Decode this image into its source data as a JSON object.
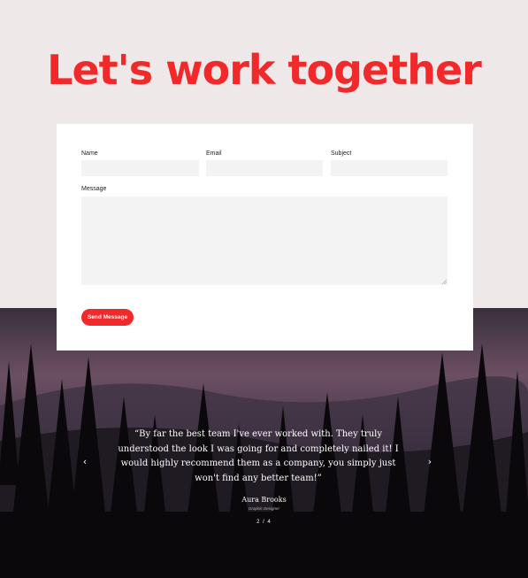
{
  "headline": "Let's work together",
  "form": {
    "name_label": "Name",
    "email_label": "Email",
    "subject_label": "Subject",
    "message_label": "Message",
    "send_label": "Send Message"
  },
  "testimonial": {
    "quote": "“By far the best team I've ever worked with. They truly understood the look I was going for and completely nailed it! I would highly recommend them as a company, you simply just won't find any better team!”",
    "author": "Aura Brooks",
    "role": "Graphic Designer",
    "pager": "2 / 4"
  },
  "icons": {
    "prev": "chevron-left-icon",
    "next": "chevron-right-icon"
  },
  "colors": {
    "accent": "#f1292b",
    "page_bg": "#efe8e8",
    "card_bg": "#ffffff",
    "field_bg": "#f3f3f3"
  }
}
